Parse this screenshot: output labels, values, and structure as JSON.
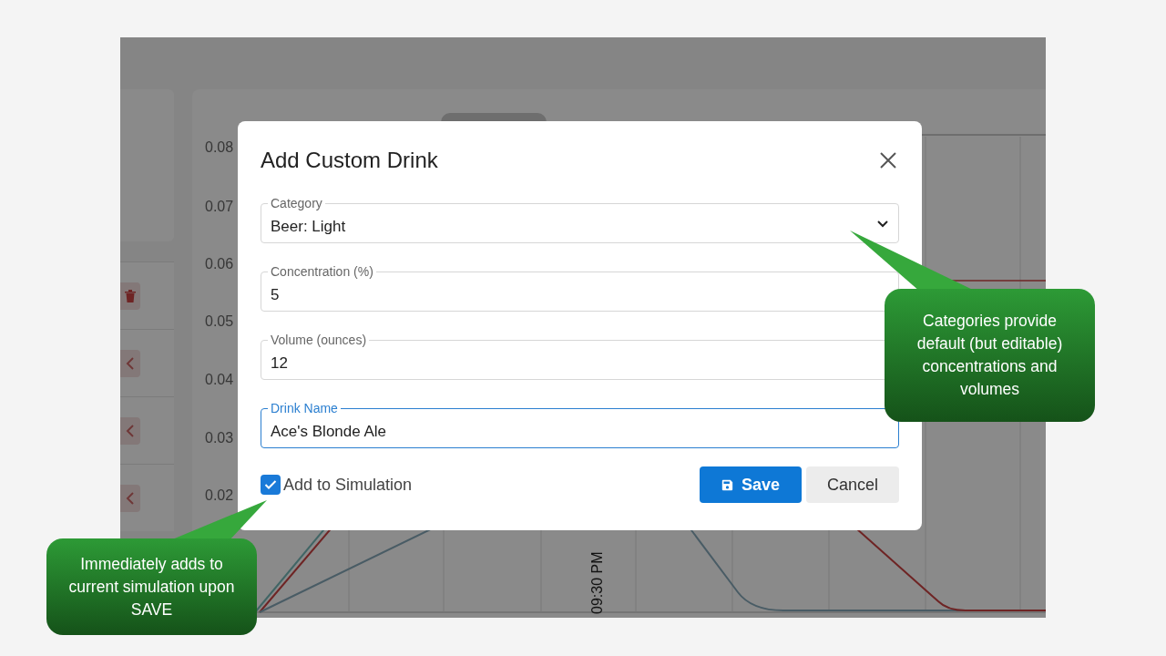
{
  "background_app": {
    "y_ticks": [
      "0.08",
      "0.07",
      "0.06",
      "0.05",
      "0.04",
      "0.03",
      "0.02"
    ],
    "x_label": "09:30 PM",
    "row_buttons": [
      {
        "kind": "delete"
      },
      {
        "kind": "collapse"
      },
      {
        "kind": "collapse"
      },
      {
        "kind": "collapse"
      }
    ]
  },
  "dialog": {
    "title": "Add Custom Drink",
    "fields": [
      {
        "label": "Category",
        "value": "Beer: Light",
        "kind": "select",
        "focused": false
      },
      {
        "label": "Concentration (%)",
        "value": "5",
        "kind": "text",
        "focused": false
      },
      {
        "label": "Volume (ounces)",
        "value": "12",
        "kind": "text",
        "focused": false
      },
      {
        "label": "Drink Name",
        "value": "Ace's Blonde Ale",
        "kind": "text",
        "focused": true
      }
    ],
    "checkbox": {
      "label": "Add to Simulation",
      "checked": true
    },
    "buttons": [
      {
        "label": "Save",
        "kind": "primary"
      },
      {
        "label": "Cancel",
        "kind": "secondary"
      }
    ]
  },
  "callouts": [
    {
      "text": "Categories provide default (but editable) concentrations and volumes",
      "kind": "right"
    },
    {
      "text": "Immediately adds to current simulation upon SAVE",
      "kind": "left"
    }
  ]
}
